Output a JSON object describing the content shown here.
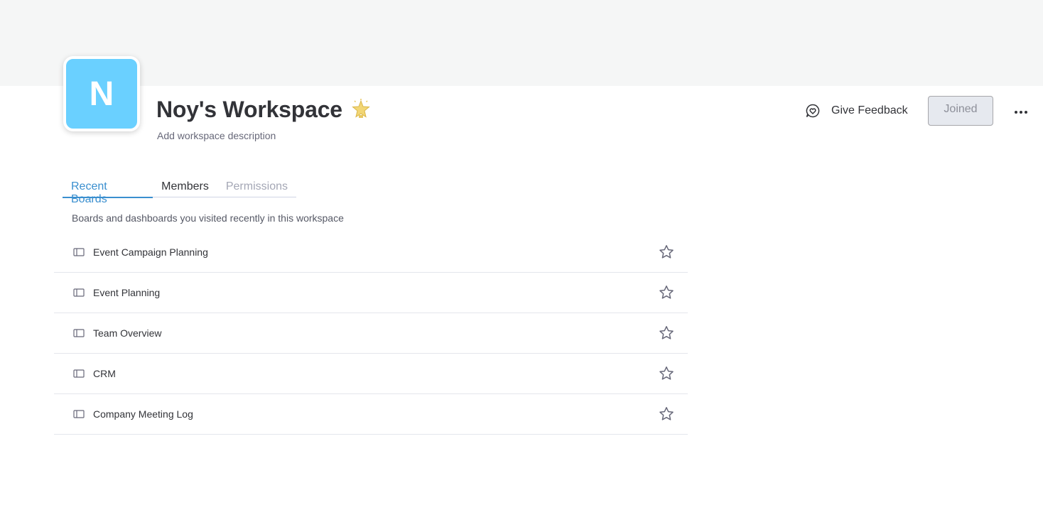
{
  "workspace": {
    "avatar_letter": "N",
    "title": "Noy's Workspace",
    "description_placeholder": "Add workspace description",
    "avatar_color": "#6ad0ff"
  },
  "header_actions": {
    "feedback_label": "Give Feedback",
    "joined_label": "Joined"
  },
  "tabs": [
    {
      "label": "Recent Boards",
      "state": "active"
    },
    {
      "label": "Members",
      "state": "normal"
    },
    {
      "label": "Permissions",
      "state": "disabled"
    }
  ],
  "recent": {
    "subtitle": "Boards and dashboards you visited recently in this workspace",
    "boards": [
      {
        "name": "Event Campaign Planning",
        "icon": "board-icon",
        "favorite_icon": "star-outline-icon"
      },
      {
        "name": "Event Planning",
        "icon": "board-icon",
        "favorite_icon": "star-outline-icon"
      },
      {
        "name": "Team Overview",
        "icon": "board-icon",
        "favorite_icon": "star-outline-icon"
      },
      {
        "name": "CRM",
        "icon": "board-icon",
        "favorite_icon": "star-outline-icon"
      },
      {
        "name": "Company Meeting Log",
        "icon": "board-icon",
        "favorite_icon": "star-outline-icon"
      }
    ]
  },
  "colors": {
    "accent": "#3a8fcf",
    "banner": "#f5f6f6",
    "text": "#323338"
  }
}
